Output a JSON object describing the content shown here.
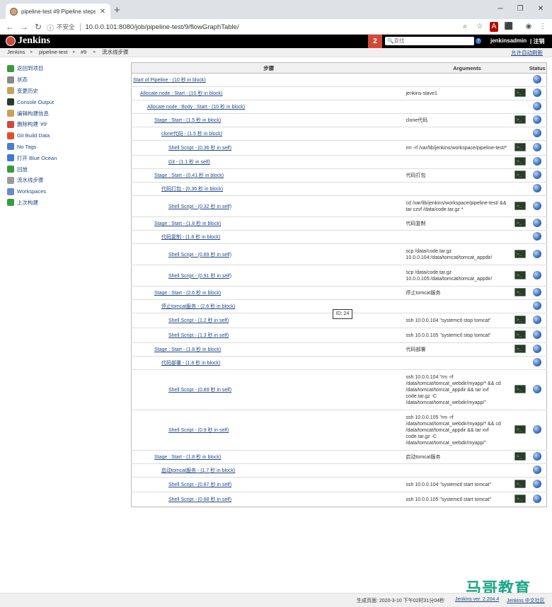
{
  "browser": {
    "tab_title": "pipeline-test #9 Pipeline steps",
    "insecure_label": "不安全",
    "url": "10.0.0.101:8080/job/pipeline-test/9/flowGraphTable/"
  },
  "header": {
    "app_name": "Jenkins",
    "notification_count": "2",
    "search_placeholder": "查找",
    "username": "jenkinsadmin",
    "logout": "| 注销"
  },
  "breadcrumbs": [
    "Jenkins",
    "pipeline-test",
    "#9",
    "流水线步骤"
  ],
  "breadcrumb_sep": "▸",
  "auto_refresh": "允许自动刷新",
  "sidebar": [
    {
      "label": "返回到项目",
      "icon": "up-arrow-icon",
      "color": "#3c9a3c"
    },
    {
      "label": "状态",
      "icon": "search-icon",
      "color": "#8a8a8a"
    },
    {
      "label": "变更历史",
      "icon": "notepad-icon",
      "color": "#c9a25a"
    },
    {
      "label": "Console Output",
      "icon": "terminal-icon",
      "color": "#2b3a2b"
    },
    {
      "label": "编辑构建信息",
      "icon": "notepad-icon",
      "color": "#c9a25a"
    },
    {
      "label": "删除构建 '#9'",
      "icon": "no-entry-icon",
      "color": "#d24939"
    },
    {
      "label": "Git Build Data",
      "icon": "git-icon",
      "color": "#e0502c"
    },
    {
      "label": "No Tags",
      "icon": "document-icon",
      "color": "#4a7fc9"
    },
    {
      "label": "打开 Blue Ocean",
      "icon": "blue-ocean-icon",
      "color": "#3d7ad4"
    },
    {
      "label": "回放",
      "icon": "replay-icon",
      "color": "#3c9a3c"
    },
    {
      "label": "流水线步骤",
      "icon": "gear-icon",
      "color": "#9a9a9a"
    },
    {
      "label": "Workspaces",
      "icon": "folder-icon",
      "color": "#6a8ac9"
    },
    {
      "label": "上次构建",
      "icon": "left-arrow-icon",
      "color": "#3c9a3c"
    }
  ],
  "table": {
    "headers": {
      "step": "步骤",
      "args": "Arguments",
      "status": "Status"
    },
    "rows": [
      {
        "level": 0,
        "step": "Start of Pipeline - (10 秒 in block)",
        "args": "",
        "console": false
      },
      {
        "level": 1,
        "step": "Allocate node : Start - (10 秒 in block)",
        "args": "jenkins-slave1",
        "console": true
      },
      {
        "level": 2,
        "step": "Allocate node : Body : Start - (10 秒 in block)",
        "args": "",
        "console": false
      },
      {
        "level": 3,
        "step": "Stage : Start - (1.5 秒 in block)",
        "args": "clone代码",
        "console": true
      },
      {
        "level": 4,
        "step": "clone代码 - (1.5 秒 in block)",
        "args": "",
        "console": false
      },
      {
        "level": 5,
        "step": "Shell Script - (0.36 秒 in self)",
        "args": "rm -rf /var/lib/jenkins/workspace/pipeline-test/*",
        "console": true
      },
      {
        "level": 5,
        "step": "Git - (1.1 秒 in self)",
        "args": "",
        "console": true
      },
      {
        "level": 3,
        "step": "Stage : Start - (0.41 秒 in block)",
        "args": "代码打包",
        "console": true
      },
      {
        "level": 4,
        "step": "代码打包 - (0.36 秒 in block)",
        "args": "",
        "console": false
      },
      {
        "level": 5,
        "step": "Shell Script - (0.32 秒 in self)",
        "args": "cd /var/lib/jenkins/workspace/pipeline-test/ && tar czvf /data/code.tar.gz *",
        "console": true
      },
      {
        "level": 3,
        "step": "Stage : Start - (1.8 秒 in block)",
        "args": "代码复制",
        "console": true
      },
      {
        "level": 4,
        "step": "代码复制 - (1.8 秒 in block)",
        "args": "",
        "console": false
      },
      {
        "level": 5,
        "step": "Shell Script - (0.89 秒 in self)",
        "args": "scp /data/code.tar.gz 10.0.0.104:/data/tomcat/tomcat_appdir/",
        "console": true
      },
      {
        "level": 5,
        "step": "Shell Script - (0.91 秒 in self)",
        "args": "scp /data/code.tar.gz 10.0.0.105:/data/tomcat/tomcat_appdir/",
        "console": true
      },
      {
        "level": 3,
        "step": "Stage : Start - (2.6 秒 in block)",
        "args": "停止tomcat服务",
        "console": true
      },
      {
        "level": 4,
        "step": "停止tomcat服务 - (2.6 秒 in block)",
        "args": "",
        "console": false
      },
      {
        "level": 5,
        "step": "Shell Script - (1.2 秒 in self)",
        "args": "ssh 10.0.0.104 \"systemctl stop tomcat\"",
        "console": true
      },
      {
        "level": 5,
        "step": "Shell Script - (1.3 秒 in self)",
        "args": "ssh 10.0.0.105 \"systemctl stop tomcat\"",
        "console": true
      },
      {
        "level": 3,
        "step": "Stage : Start - (1.8 秒 in block)",
        "args": "代码部署",
        "console": true
      },
      {
        "level": 4,
        "step": "代码部署 - (1.8 秒 in block)",
        "args": "",
        "console": false
      },
      {
        "level": 5,
        "step": "Shell Script - (0.89 秒 in self)",
        "args": "ssh 10.0.0.104 \"rm -rf /data/tomcat/tomcat_webdir/myapp/* && cd /data/tomcat/tomcat_appdir && tar xvf code.tar.gz -C /data/tomcat/tomcat_webdir/myapp/\"",
        "console": true
      },
      {
        "level": 5,
        "step": "Shell Script - (0.9 秒 in self)",
        "args": "ssh 10.0.0.105 \"rm -rf /data/tomcat/tomcat_webdir/myapp/* && cd /data/tomcat/tomcat_appdir && tar xvf code.tar.gz -C /data/tomcat/tomcat_webdir/myapp/\"",
        "console": true
      },
      {
        "level": 3,
        "step": "Stage : Start - (1.8 秒 in block)",
        "args": "启动tomcat服务",
        "console": true
      },
      {
        "level": 4,
        "step": "启动tomcat服务 - (1.7 秒 in block)",
        "args": "",
        "console": false
      },
      {
        "level": 5,
        "step": "Shell Script - (0.87 秒 in self)",
        "args": "ssh 10.0.0.104 \"systemctl start tomcat\"",
        "console": true
      },
      {
        "level": 5,
        "step": "Shell Script - (0.88 秒 in self)",
        "args": "ssh 10.0.0.105 \"systemctl start tomcat\"",
        "console": true
      }
    ]
  },
  "tooltip": "ID: 24",
  "footer": {
    "generated": "生成页面: 2020-3-10 下午02时31分04秒",
    "version": "Jenkins ver. 2.204.4",
    "community": "Jenkins 中文社区"
  },
  "watermark": "马哥教育"
}
